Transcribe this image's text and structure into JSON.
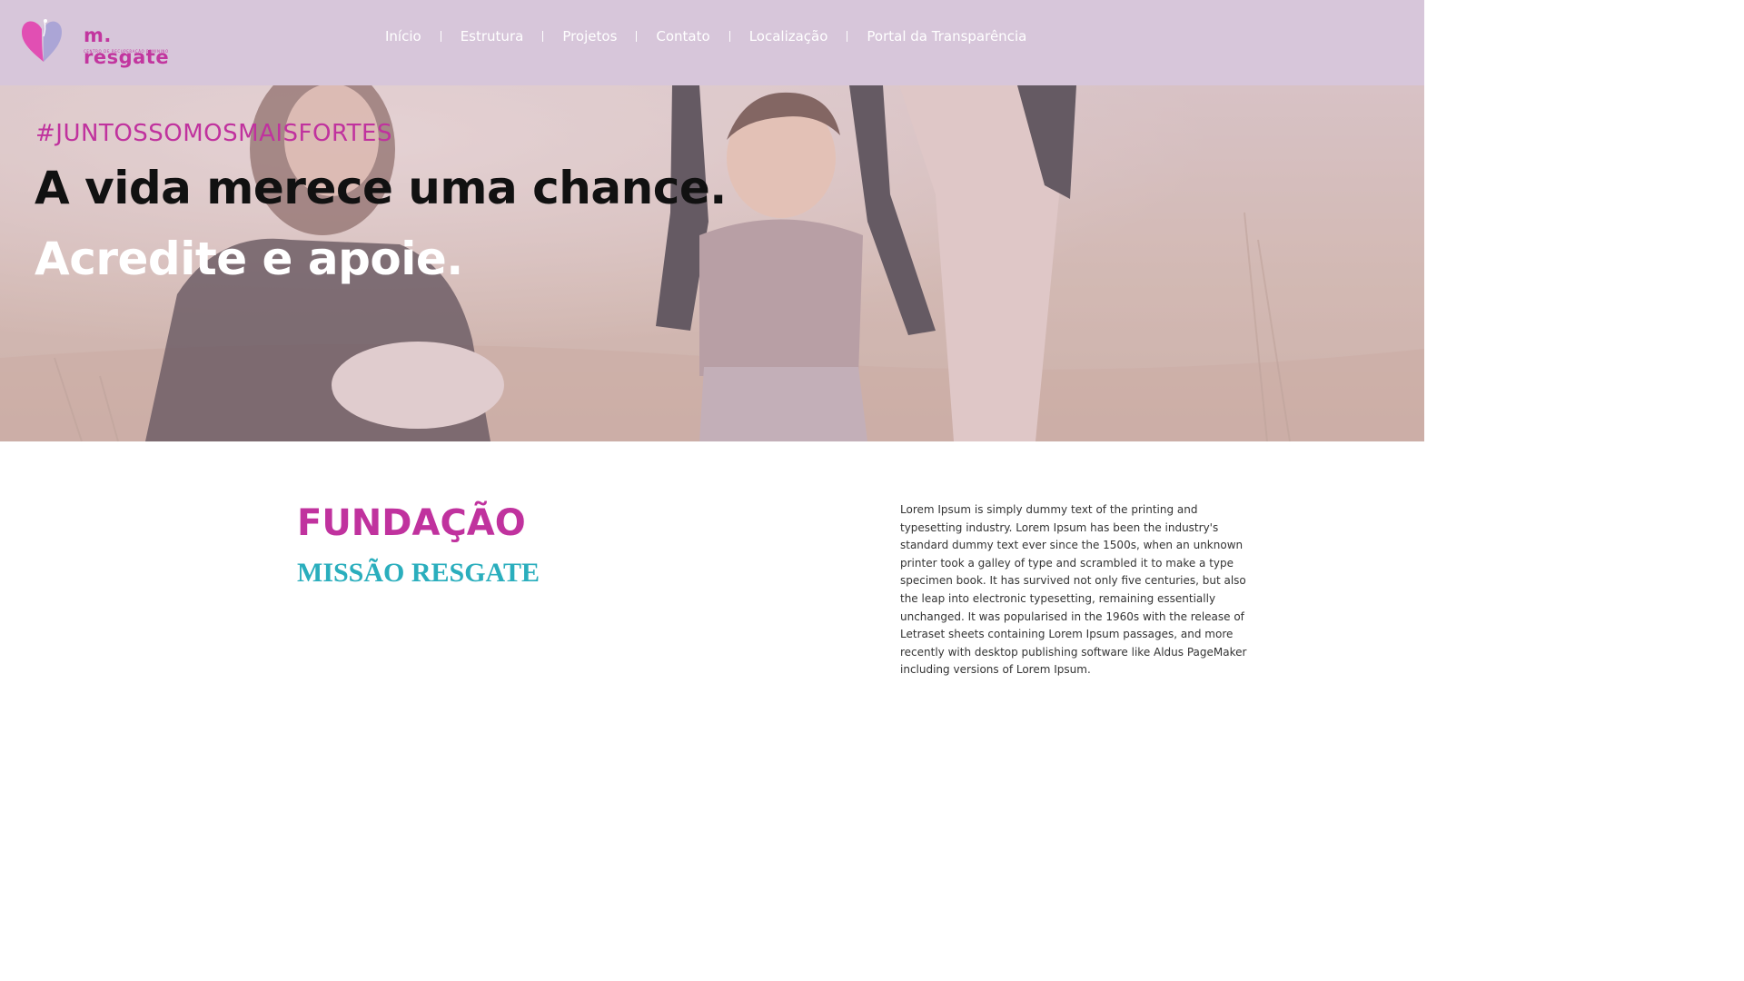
{
  "brand": {
    "name": "m. resgate",
    "tagline": "CENTRO DE RECUPERAÇÃO FEMININO",
    "colors": {
      "header_bg": "#d7c6da",
      "accent_magenta": "#c0329e",
      "accent_teal": "#2aaebd",
      "heart_pink": "#e14fb3",
      "heart_lavender": "#a9a3d6"
    }
  },
  "nav": {
    "items": [
      {
        "label": "Início"
      },
      {
        "label": "Estrutura"
      },
      {
        "label": "Projetos"
      },
      {
        "label": "Contato"
      },
      {
        "label": "Localização"
      },
      {
        "label": "Portal da Transparência"
      }
    ]
  },
  "hero": {
    "hashtag": "#JUNTOSSOMOSMAISFORTES",
    "line1": "A vida merece uma chance.",
    "line2": "Acredite e apoie."
  },
  "about": {
    "title": "FUNDAÇÃO",
    "subtitle": "MISSÃO RESGATE",
    "body": "Lorem Ipsum is simply dummy text of the printing and typesetting industry. Lorem Ipsum has been the industry's standard dummy text ever since the 1500s, when an unknown printer took a galley of type and scrambled it to make a type specimen book. It has survived not only five centuries, but also the leap into electronic typesetting, remaining essentially unchanged. It was popularised in the 1960s with the release of Letraset sheets containing Lorem Ipsum passages, and more recently with desktop publishing software like Aldus PageMaker including versions of Lorem Ipsum."
  }
}
